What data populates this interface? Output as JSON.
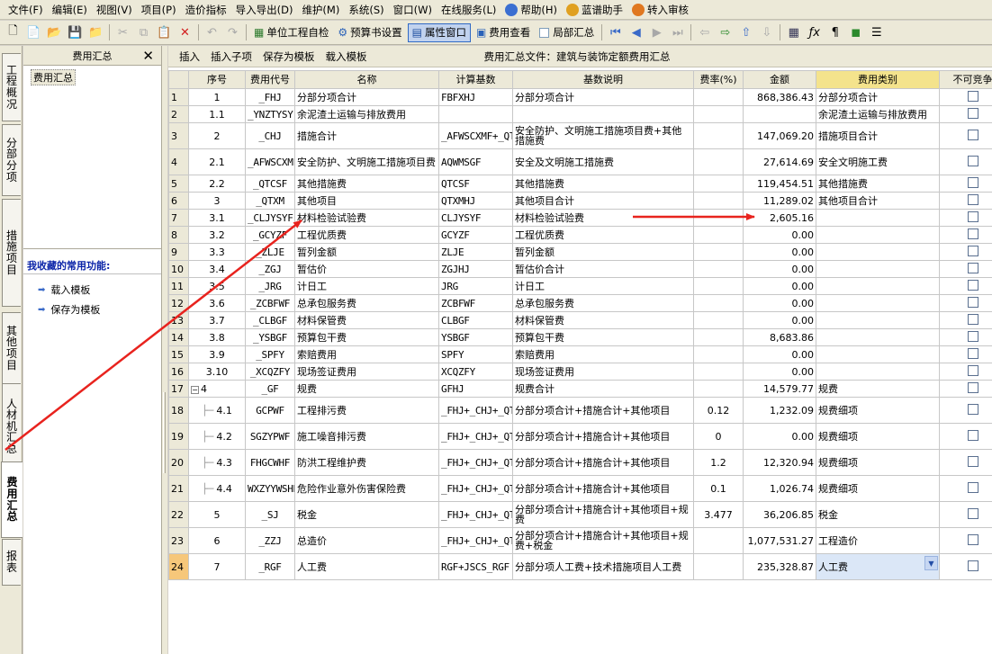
{
  "menu": {
    "items": [
      "文件(F)",
      "编辑(E)",
      "视图(V)",
      "项目(P)",
      "造价指标",
      "导入导出(D)",
      "维护(M)",
      "系统(S)",
      "窗口(W)",
      "在线服务(L)",
      "帮助(H)",
      "蓝谱助手",
      "转入审核"
    ]
  },
  "toolbar": {
    "btn_check": "单位工程自检",
    "btn_settings": "预算书设置",
    "btn_props": "属性窗口",
    "btn_fees": "费用查看",
    "btn_partial": "局部汇总"
  },
  "tabs": [
    "工程概况",
    "分部分项",
    "措施项目",
    "其他项目",
    "人材机汇总",
    "费用汇总",
    "报表"
  ],
  "left_panel": {
    "title": "费用汇总",
    "tree_item": "费用汇总",
    "fav_title": "我收藏的常用功能:",
    "links": [
      "载入模板",
      "保存为模板"
    ]
  },
  "main_toolbar": {
    "insert": "插入",
    "insert_child": "插入子项",
    "save_template": "保存为模板",
    "load_template": "载入模板",
    "file_title": "费用汇总文件：建筑与装饰定额费用汇总"
  },
  "table": {
    "headers": [
      "",
      "序号",
      "费用代号",
      "名称",
      "计算基数",
      "基数说明",
      "费率(%)",
      "金额",
      "费用类别",
      "不可竞争"
    ],
    "rows": [
      {
        "rn": "1",
        "no": "1",
        "code": "_FHJ",
        "name": "分部分项合计",
        "base": "FBFXHJ",
        "desc": "分部分项合计",
        "rate": "",
        "amount": "868,386.43",
        "cat": "分部分项合计"
      },
      {
        "rn": "2",
        "no": "1.1",
        "code": "_YNZTYSY",
        "name": "余泥渣土运输与排放费用",
        "base": "",
        "desc": "",
        "rate": "",
        "amount": "",
        "cat": "余泥渣土运输与排放费用"
      },
      {
        "rn": "3",
        "no": "2",
        "code": "_CHJ",
        "name": "措施合计",
        "base": "_AFWSCXMF+_QTCSF",
        "desc": "安全防护、文明施工措施项目费+其他措施费",
        "rate": "",
        "amount": "147,069.20",
        "cat": "措施项目合计"
      },
      {
        "rn": "4",
        "no": "2.1",
        "code": "_AFWSCXMF",
        "name": "安全防护、文明施工措施项目费",
        "base": "AQWMSGF",
        "desc": "安全及文明施工措施费",
        "rate": "",
        "amount": "27,614.69",
        "cat": "安全文明施工费"
      },
      {
        "rn": "5",
        "no": "2.2",
        "code": "_QTCSF",
        "name": "其他措施费",
        "base": "QTCSF",
        "desc": "其他措施费",
        "rate": "",
        "amount": "119,454.51",
        "cat": "其他措施费"
      },
      {
        "rn": "6",
        "no": "3",
        "code": "_QTXM",
        "name": "其他项目",
        "base": "QTXMHJ",
        "desc": "其他项目合计",
        "rate": "",
        "amount": "11,289.02",
        "cat": "其他项目合计"
      },
      {
        "rn": "7",
        "no": "3.1",
        "code": "_CLJYSYF",
        "name": "材料检验试验费",
        "base": "CLJYSYF",
        "desc": "材料检验试验费",
        "rate": "",
        "amount": "2,605.16",
        "cat": ""
      },
      {
        "rn": "8",
        "no": "3.2",
        "code": "_GCYZF",
        "name": "工程优质费",
        "base": "GCYZF",
        "desc": "工程优质费",
        "rate": "",
        "amount": "0.00",
        "cat": ""
      },
      {
        "rn": "9",
        "no": "3.3",
        "code": "_ZLJE",
        "name": "暂列金额",
        "base": "ZLJE",
        "desc": "暂列金额",
        "rate": "",
        "amount": "0.00",
        "cat": ""
      },
      {
        "rn": "10",
        "no": "3.4",
        "code": "_ZGJ",
        "name": "暂估价",
        "base": "ZGJHJ",
        "desc": "暂估价合计",
        "rate": "",
        "amount": "0.00",
        "cat": ""
      },
      {
        "rn": "11",
        "no": "3.5",
        "code": "_JRG",
        "name": "计日工",
        "base": "JRG",
        "desc": "计日工",
        "rate": "",
        "amount": "0.00",
        "cat": ""
      },
      {
        "rn": "12",
        "no": "3.6",
        "code": "_ZCBFWF",
        "name": "总承包服务费",
        "base": "ZCBFWF",
        "desc": "总承包服务费",
        "rate": "",
        "amount": "0.00",
        "cat": ""
      },
      {
        "rn": "13",
        "no": "3.7",
        "code": "_CLBGF",
        "name": "材料保管费",
        "base": "CLBGF",
        "desc": "材料保管费",
        "rate": "",
        "amount": "0.00",
        "cat": ""
      },
      {
        "rn": "14",
        "no": "3.8",
        "code": "_YSBGF",
        "name": "预算包干费",
        "base": "YSBGF",
        "desc": "预算包干费",
        "rate": "",
        "amount": "8,683.86",
        "cat": ""
      },
      {
        "rn": "15",
        "no": "3.9",
        "code": "_SPFY",
        "name": "索赔费用",
        "base": "SPFY",
        "desc": "索赔费用",
        "rate": "",
        "amount": "0.00",
        "cat": ""
      },
      {
        "rn": "16",
        "no": "3.10",
        "code": "_XCQZFY",
        "name": "现场签证费用",
        "base": "XCQZFY",
        "desc": "现场签证费用",
        "rate": "",
        "amount": "0.00",
        "cat": ""
      },
      {
        "rn": "17",
        "no": "4",
        "code": "_GF",
        "name": "规费",
        "base": "GFHJ",
        "desc": "规费合计",
        "rate": "",
        "amount": "14,579.77",
        "cat": "规费"
      },
      {
        "rn": "18",
        "no": "4.1",
        "code": "GCPWF",
        "name": "工程排污费",
        "base": "_FHJ+_CHJ+_QTXM",
        "desc": "分部分项合计+措施合计+其他项目",
        "rate": "0.12",
        "amount": "1,232.09",
        "cat": "规费细项"
      },
      {
        "rn": "19",
        "no": "4.2",
        "code": "SGZYPWF",
        "name": "施工噪音排污费",
        "base": "_FHJ+_CHJ+_QTXM",
        "desc": "分部分项合计+措施合计+其他项目",
        "rate": "0",
        "amount": "0.00",
        "cat": "规费细项"
      },
      {
        "rn": "20",
        "no": "4.3",
        "code": "FHGCWHF",
        "name": "防洪工程维护费",
        "base": "_FHJ+_CHJ+_QTXM",
        "desc": "分部分项合计+措施合计+其他项目",
        "rate": "1.2",
        "amount": "12,320.94",
        "cat": "规费细项"
      },
      {
        "rn": "21",
        "no": "4.4",
        "code": "WXZYYWSHBXF",
        "name": "危险作业意外伤害保险费",
        "base": "_FHJ+_CHJ+_QTXM",
        "desc": "分部分项合计+措施合计+其他项目",
        "rate": "0.1",
        "amount": "1,026.74",
        "cat": "规费细项"
      },
      {
        "rn": "22",
        "no": "5",
        "code": "_SJ",
        "name": "税金",
        "base": "_FHJ+_CHJ+_QTXM+_GF",
        "desc": "分部分项合计+措施合计+其他项目+规费",
        "rate": "3.477",
        "amount": "36,206.85",
        "cat": "税金"
      },
      {
        "rn": "23",
        "no": "6",
        "code": "_ZZJ",
        "name": "总造价",
        "base": "_FHJ+_CHJ+_QTXM+_GF+_SJ",
        "desc": "分部分项合计+措施合计+其他项目+规费+税金",
        "rate": "",
        "amount": "1,077,531.27",
        "cat": "工程造价"
      },
      {
        "rn": "24",
        "no": "7",
        "code": "_RGF",
        "name": "人工费",
        "base": "RGF+JSCS_RGF",
        "desc": "分部分项人工费+技术措施项目人工费",
        "rate": "",
        "amount": "235,328.87",
        "cat": "人工费"
      }
    ]
  },
  "colors": {
    "annotation_arrow": "#e8231e",
    "header_highlight": "#f4e38c",
    "selected_row": "#f6c77a"
  }
}
